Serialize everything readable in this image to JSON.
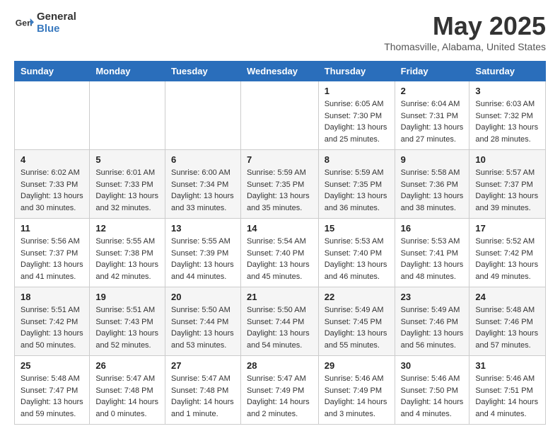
{
  "header": {
    "logo_general": "General",
    "logo_blue": "Blue",
    "title": "May 2025",
    "subtitle": "Thomasville, Alabama, United States"
  },
  "days_of_week": [
    "Sunday",
    "Monday",
    "Tuesday",
    "Wednesday",
    "Thursday",
    "Friday",
    "Saturday"
  ],
  "weeks": [
    [
      {
        "day": "",
        "info": ""
      },
      {
        "day": "",
        "info": ""
      },
      {
        "day": "",
        "info": ""
      },
      {
        "day": "",
        "info": ""
      },
      {
        "day": "1",
        "info": "Sunrise: 6:05 AM\nSunset: 7:30 PM\nDaylight: 13 hours\nand 25 minutes."
      },
      {
        "day": "2",
        "info": "Sunrise: 6:04 AM\nSunset: 7:31 PM\nDaylight: 13 hours\nand 27 minutes."
      },
      {
        "day": "3",
        "info": "Sunrise: 6:03 AM\nSunset: 7:32 PM\nDaylight: 13 hours\nand 28 minutes."
      }
    ],
    [
      {
        "day": "4",
        "info": "Sunrise: 6:02 AM\nSunset: 7:33 PM\nDaylight: 13 hours\nand 30 minutes."
      },
      {
        "day": "5",
        "info": "Sunrise: 6:01 AM\nSunset: 7:33 PM\nDaylight: 13 hours\nand 32 minutes."
      },
      {
        "day": "6",
        "info": "Sunrise: 6:00 AM\nSunset: 7:34 PM\nDaylight: 13 hours\nand 33 minutes."
      },
      {
        "day": "7",
        "info": "Sunrise: 5:59 AM\nSunset: 7:35 PM\nDaylight: 13 hours\nand 35 minutes."
      },
      {
        "day": "8",
        "info": "Sunrise: 5:59 AM\nSunset: 7:35 PM\nDaylight: 13 hours\nand 36 minutes."
      },
      {
        "day": "9",
        "info": "Sunrise: 5:58 AM\nSunset: 7:36 PM\nDaylight: 13 hours\nand 38 minutes."
      },
      {
        "day": "10",
        "info": "Sunrise: 5:57 AM\nSunset: 7:37 PM\nDaylight: 13 hours\nand 39 minutes."
      }
    ],
    [
      {
        "day": "11",
        "info": "Sunrise: 5:56 AM\nSunset: 7:37 PM\nDaylight: 13 hours\nand 41 minutes."
      },
      {
        "day": "12",
        "info": "Sunrise: 5:55 AM\nSunset: 7:38 PM\nDaylight: 13 hours\nand 42 minutes."
      },
      {
        "day": "13",
        "info": "Sunrise: 5:55 AM\nSunset: 7:39 PM\nDaylight: 13 hours\nand 44 minutes."
      },
      {
        "day": "14",
        "info": "Sunrise: 5:54 AM\nSunset: 7:40 PM\nDaylight: 13 hours\nand 45 minutes."
      },
      {
        "day": "15",
        "info": "Sunrise: 5:53 AM\nSunset: 7:40 PM\nDaylight: 13 hours\nand 46 minutes."
      },
      {
        "day": "16",
        "info": "Sunrise: 5:53 AM\nSunset: 7:41 PM\nDaylight: 13 hours\nand 48 minutes."
      },
      {
        "day": "17",
        "info": "Sunrise: 5:52 AM\nSunset: 7:42 PM\nDaylight: 13 hours\nand 49 minutes."
      }
    ],
    [
      {
        "day": "18",
        "info": "Sunrise: 5:51 AM\nSunset: 7:42 PM\nDaylight: 13 hours\nand 50 minutes."
      },
      {
        "day": "19",
        "info": "Sunrise: 5:51 AM\nSunset: 7:43 PM\nDaylight: 13 hours\nand 52 minutes."
      },
      {
        "day": "20",
        "info": "Sunrise: 5:50 AM\nSunset: 7:44 PM\nDaylight: 13 hours\nand 53 minutes."
      },
      {
        "day": "21",
        "info": "Sunrise: 5:50 AM\nSunset: 7:44 PM\nDaylight: 13 hours\nand 54 minutes."
      },
      {
        "day": "22",
        "info": "Sunrise: 5:49 AM\nSunset: 7:45 PM\nDaylight: 13 hours\nand 55 minutes."
      },
      {
        "day": "23",
        "info": "Sunrise: 5:49 AM\nSunset: 7:46 PM\nDaylight: 13 hours\nand 56 minutes."
      },
      {
        "day": "24",
        "info": "Sunrise: 5:48 AM\nSunset: 7:46 PM\nDaylight: 13 hours\nand 57 minutes."
      }
    ],
    [
      {
        "day": "25",
        "info": "Sunrise: 5:48 AM\nSunset: 7:47 PM\nDaylight: 13 hours\nand 59 minutes."
      },
      {
        "day": "26",
        "info": "Sunrise: 5:47 AM\nSunset: 7:48 PM\nDaylight: 14 hours\nand 0 minutes."
      },
      {
        "day": "27",
        "info": "Sunrise: 5:47 AM\nSunset: 7:48 PM\nDaylight: 14 hours\nand 1 minute."
      },
      {
        "day": "28",
        "info": "Sunrise: 5:47 AM\nSunset: 7:49 PM\nDaylight: 14 hours\nand 2 minutes."
      },
      {
        "day": "29",
        "info": "Sunrise: 5:46 AM\nSunset: 7:49 PM\nDaylight: 14 hours\nand 3 minutes."
      },
      {
        "day": "30",
        "info": "Sunrise: 5:46 AM\nSunset: 7:50 PM\nDaylight: 14 hours\nand 4 minutes."
      },
      {
        "day": "31",
        "info": "Sunrise: 5:46 AM\nSunset: 7:51 PM\nDaylight: 14 hours\nand 4 minutes."
      }
    ]
  ]
}
